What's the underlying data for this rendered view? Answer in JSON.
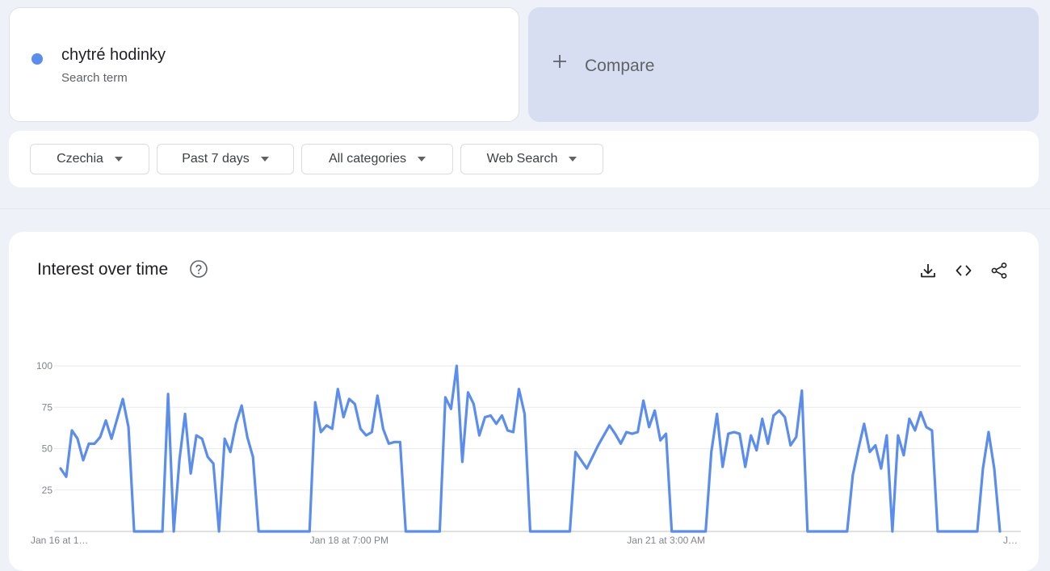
{
  "search_term": {
    "name": "chytré hodinky",
    "subtitle": "Search term",
    "color": "#5b8def"
  },
  "compare": {
    "label": "Compare",
    "icon": "plus-icon"
  },
  "filters": [
    {
      "label": "Czechia"
    },
    {
      "label": "Past 7 days"
    },
    {
      "label": "All categories"
    },
    {
      "label": "Web Search"
    }
  ],
  "chart_card": {
    "title": "Interest over time",
    "actions": [
      "download-icon",
      "embed-code-icon",
      "share-icon"
    ]
  },
  "chart_data": {
    "type": "line",
    "title": "Interest over time",
    "xlabel": "",
    "ylabel": "",
    "ylim": [
      0,
      100
    ],
    "yticks": [
      0,
      25,
      50,
      75,
      100
    ],
    "ytick_labels": [
      "",
      "25",
      "50",
      "75",
      "100"
    ],
    "grid": true,
    "xlim": [
      0,
      168
    ],
    "xticks": [
      {
        "x": 0,
        "label": "Jan 16 at 1…"
      },
      {
        "x": 51,
        "label": "Jan 18 at 7:00 PM"
      },
      {
        "x": 107,
        "label": "Jan 21 at 3:00 AM"
      },
      {
        "x": 168,
        "label": "J…"
      }
    ],
    "series": [
      {
        "color": "#5b8def",
        "partial_from_index": 167,
        "values": [
          38,
          33,
          61,
          56,
          43,
          53,
          53,
          57,
          67,
          56,
          68,
          80,
          63,
          0,
          0,
          0,
          0,
          0,
          0,
          83,
          0,
          43,
          71,
          35,
          58,
          56,
          45,
          41,
          0,
          56,
          48,
          65,
          76,
          57,
          45,
          0,
          0,
          0,
          0,
          0,
          0,
          0,
          0,
          0,
          0,
          78,
          60,
          64,
          62,
          86,
          69,
          80,
          77,
          62,
          58,
          60,
          82,
          62,
          53,
          54,
          54,
          0,
          0,
          0,
          0,
          0,
          0,
          0,
          81,
          74,
          100,
          42,
          84,
          77,
          58,
          69,
          70,
          65,
          70,
          61,
          60,
          86,
          71,
          0,
          0,
          0,
          0,
          0,
          0,
          0,
          0,
          48,
          43,
          38,
          45,
          52,
          58,
          64,
          59,
          53,
          60,
          59,
          60,
          79,
          63,
          73,
          55,
          59,
          0,
          0,
          0,
          0,
          0,
          0,
          0,
          48,
          71,
          39,
          59,
          60,
          59,
          39,
          58,
          49,
          68,
          53,
          70,
          73,
          69,
          52,
          57,
          85,
          0,
          0,
          0,
          0,
          0,
          0,
          0,
          0,
          34,
          50,
          65,
          48,
          52,
          38,
          58,
          0,
          58,
          46,
          68,
          61,
          72,
          63,
          61,
          0,
          0,
          0,
          0,
          0,
          0,
          0,
          0,
          38,
          60,
          38,
          0
        ]
      }
    ]
  }
}
